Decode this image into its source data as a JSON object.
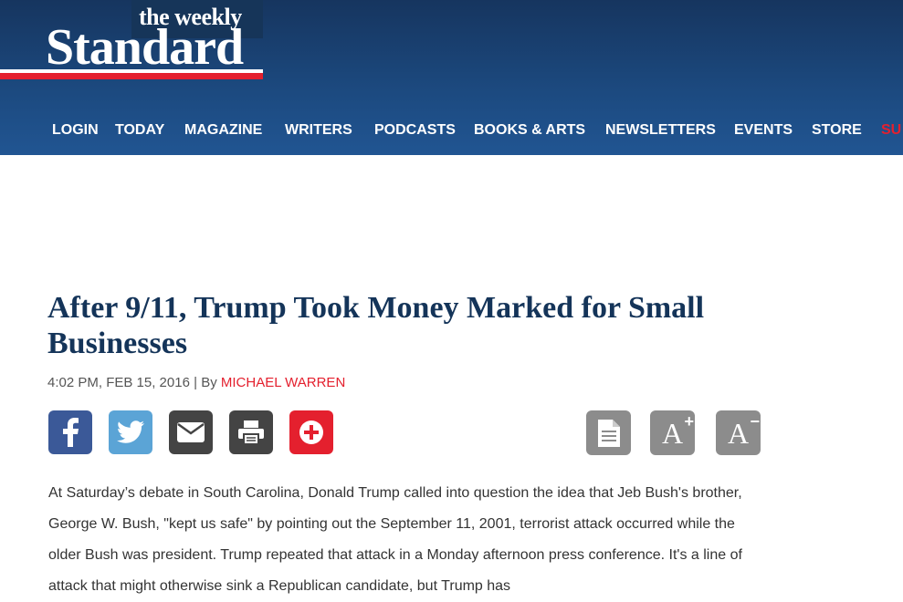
{
  "brand": {
    "logo_top": "the weekly",
    "logo_main": "Standard",
    "colors": {
      "header_blue": "#1c4a80",
      "accent_red": "#e4202e",
      "headline_navy": "#143459"
    }
  },
  "nav": {
    "items": [
      "LOGIN",
      "TODAY",
      "MAGAZINE",
      "WRITERS",
      "PODCASTS",
      "BOOKS & ARTS",
      "NEWSLETTERS",
      "EVENTS",
      "STORE",
      "SU"
    ]
  },
  "article": {
    "headline": "After 9/11, Trump Took Money Marked for Small Businesses",
    "timestamp": "4:02 PM, FEB 15, 2016",
    "separator": "|",
    "by": "By",
    "author": "MICHAEL WARREN",
    "paragraph": "At Saturday’s debate in South Carolina, Donald Trump called into question the idea that Jeb Bush's brother, George W. Bush, \"kept us safe\" by pointing out the September 11, 2001, terrorist attack occurred while the older Bush was president. Trump repeated that attack in a Monday afternoon press conference. It's a line of attack that might otherwise sink a Republican candidate, but Trump has"
  },
  "share_icons": [
    "facebook-icon",
    "twitter-icon",
    "email-icon",
    "print-icon",
    "plus-icon"
  ],
  "tool_icons": [
    "document-icon",
    "font-increase-icon",
    "font-decrease-icon"
  ],
  "tools": {
    "increase_symbol": "+",
    "decrease_symbol": "−",
    "a_letter": "A"
  }
}
